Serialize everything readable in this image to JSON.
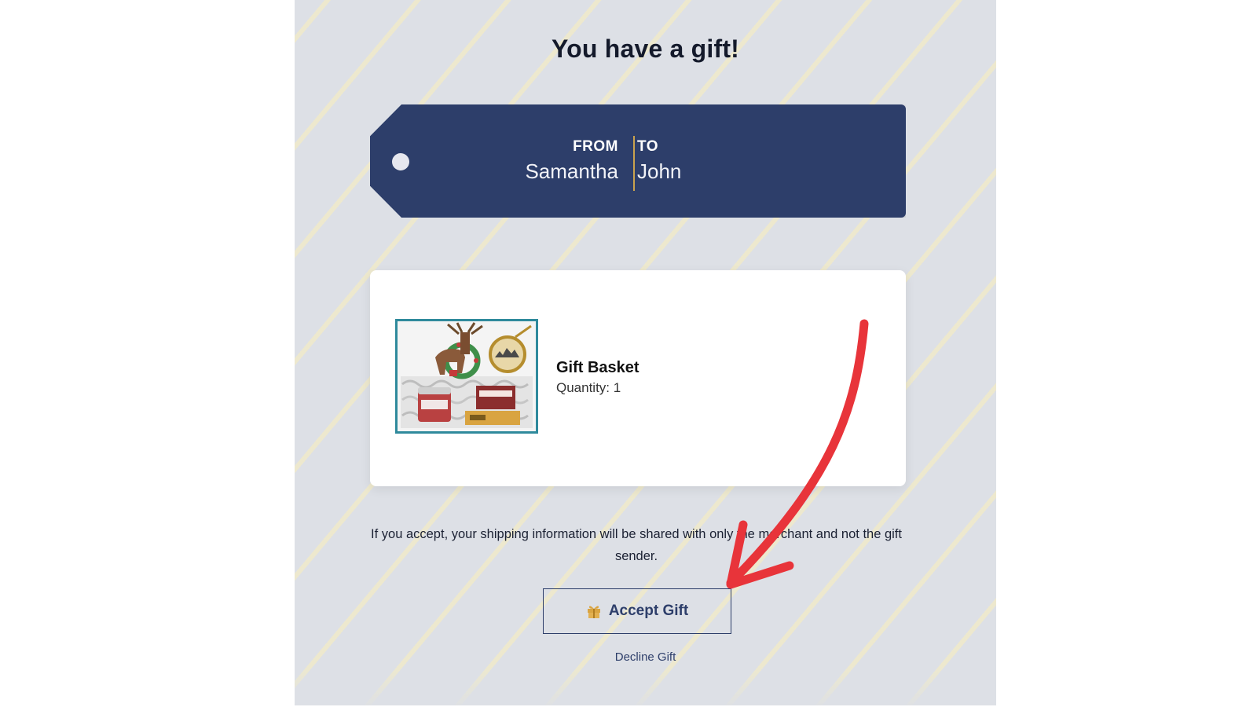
{
  "page": {
    "title": "You have a gift!"
  },
  "tag": {
    "from_label": "FROM",
    "from_name": "Samantha",
    "to_label": "TO",
    "to_name": "John"
  },
  "product": {
    "name": "Gift Basket",
    "quantity": "Quantity: 1"
  },
  "disclaimer": "If you accept, your shipping information will be shared with only the merchant and not the gift sender.",
  "actions": {
    "accept_label": "Accept Gift",
    "accept_icon": "gift-icon",
    "decline_label": "Decline Gift"
  },
  "colors": {
    "navy": "#2d3e6a",
    "tag_divider": "#c9a24e",
    "gift_icon": "#d9a441",
    "annotation_arrow": "#e8343a",
    "background": "#dde0e6",
    "stripe": "#eee9cd"
  }
}
